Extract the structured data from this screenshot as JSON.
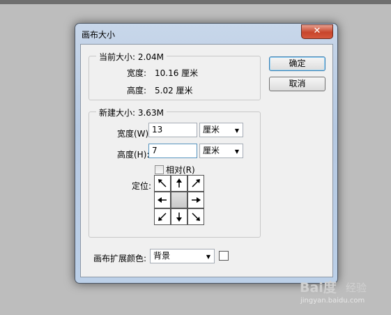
{
  "dialog": {
    "title": "画布大小",
    "close_label": "✕"
  },
  "current_size": {
    "legend": "当前大小: 2.04M",
    "width_label": "宽度:",
    "width_value": "10.16 厘米",
    "height_label": "高度:",
    "height_value": "5.02 厘米"
  },
  "new_size": {
    "legend": "新建大小: 3.63M",
    "width_label": "宽度(W):",
    "width_value": "13",
    "width_unit": "厘米",
    "height_label": "高度(H):",
    "height_value": "7",
    "height_unit": "厘米",
    "relative_label": "相对(R)",
    "relative_checked": false,
    "anchor_label": "定位:",
    "anchor_selected": "center"
  },
  "extension": {
    "label": "画布扩展颜色:",
    "value": "背景",
    "swatch_color": "#ffffff"
  },
  "buttons": {
    "ok": "确定",
    "cancel": "取消"
  },
  "watermark": {
    "logo": "Bai度",
    "brand": "经验",
    "url": "jingyan.baidu.com"
  },
  "icons": {
    "dropdown": "▼"
  }
}
